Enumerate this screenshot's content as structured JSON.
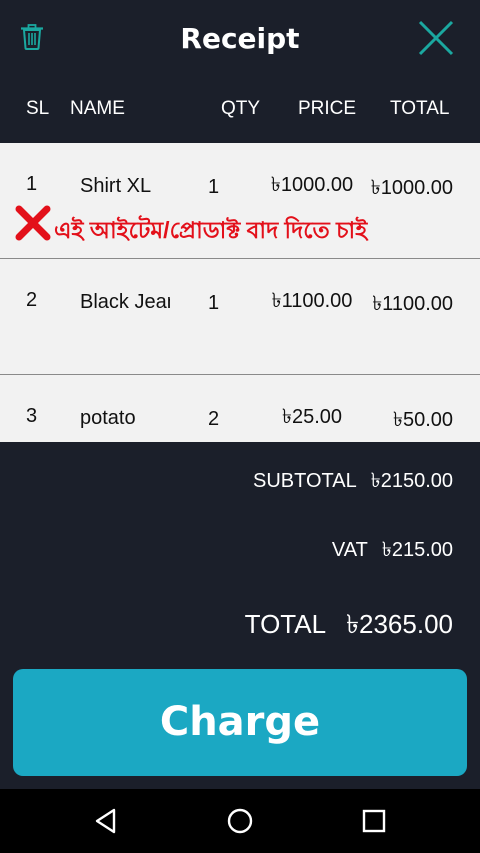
{
  "header": {
    "title": "Receipt",
    "delete_icon": "trash-icon",
    "close_icon": "close-x-icon"
  },
  "columns": {
    "sl": "SL",
    "name": "NAME",
    "qty": "QTY",
    "price": "PRICE",
    "total": "TOTAL"
  },
  "items": [
    {
      "sl": "1",
      "name": "Shirt XL",
      "qty": "1",
      "price": "৳1000.00",
      "total": "৳1000.00"
    },
    {
      "sl": "2",
      "name": "Black Jeans",
      "qty": "1",
      "price": "৳1100.00",
      "total": "৳1100.00"
    },
    {
      "sl": "3",
      "name": "potato",
      "qty": "2",
      "price": "৳25.00",
      "total": "৳50.00"
    }
  ],
  "annotation": {
    "icon": "red-x-mark-icon",
    "text": "এই আইটেম/প্রোডাক্ট বাদ দিতে চাই"
  },
  "summary": {
    "subtotal_label": "SUBTOTAL",
    "subtotal_value": "৳2150.00",
    "vat_label": "VAT",
    "vat_value": "৳215.00",
    "total_label": "TOTAL",
    "total_value": "৳2365.00"
  },
  "actions": {
    "charge_label": "Charge"
  },
  "colors": {
    "background": "#1b1f2a",
    "row_background": "#f2f2f2",
    "accent": "#1ba8c3",
    "close_icon": "#1ba8a0",
    "annotation": "#e3101a"
  }
}
